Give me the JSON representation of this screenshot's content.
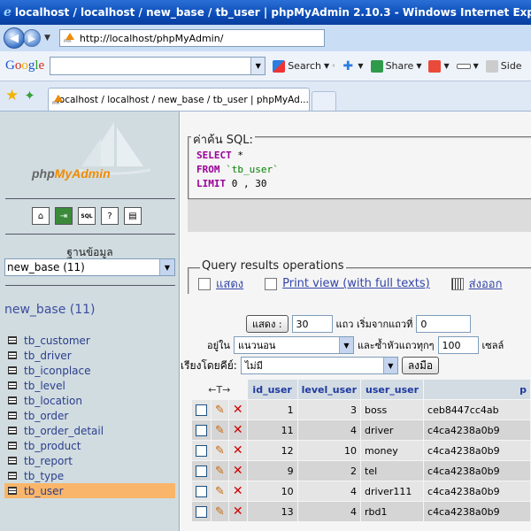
{
  "window": {
    "title": "localhost / localhost / new_base / tb_user | phpMyAdmin 2.10.3 - Windows Internet Explorer"
  },
  "address": {
    "url": "http://localhost/phpMyAdmin/"
  },
  "google_toolbar": {
    "logo": "Google",
    "search_label": "Search",
    "share_label": "Share",
    "side_label": "Side"
  },
  "tab": {
    "title": "localhost / localhost / new_base / tb_user | phpMyAd..."
  },
  "sidebar": {
    "logo_php": "php",
    "logo_myadmin": "MyAdmin",
    "db_label": "ฐานข้อมูล",
    "db_select_value": "new_base (11)",
    "db_title": "new_base (11)",
    "tables": [
      {
        "label": "tb_customer"
      },
      {
        "label": "tb_driver"
      },
      {
        "label": "tb_iconplace"
      },
      {
        "label": "tb_level"
      },
      {
        "label": "tb_location"
      },
      {
        "label": "tb_order"
      },
      {
        "label": "tb_order_detail"
      },
      {
        "label": "tb_product"
      },
      {
        "label": "tb_report"
      },
      {
        "label": "tb_type"
      },
      {
        "label": "tb_user",
        "active": true
      }
    ]
  },
  "sql_section": {
    "legend": "ค่าค้น SQL:",
    "kw_select": "SELECT",
    "select_rest": " *",
    "kw_from": "FROM",
    "from_rest": " `tb_user`",
    "kw_limit": "LIMIT",
    "limit_rest": " 0 , 30"
  },
  "query_ops": {
    "legend": "Query results operations",
    "show_label": "แสดง",
    "print_label": "Print view (with full texts)",
    "export_label": "ส่งออก"
  },
  "navigation": {
    "show_button": "แสดง :",
    "rows_value": "30",
    "rows_text": "แถว เริ่มจากแถวที่",
    "start_value": "0",
    "in_label": "อยู่ใน",
    "mode_value": "แนวนอน",
    "repeat_text": "และซ้ำหัวแถวทุกๆ",
    "repeat_value": "100",
    "cells_text": "เซลล์",
    "sort_label": "เรียงโดยคีย์:",
    "sort_value": "ไม่มี",
    "go_button": "ลงมือ"
  },
  "results": {
    "headers": [
      "←T→",
      "id_user",
      "level_user",
      "user_user",
      "p"
    ],
    "rows": [
      {
        "id": "1",
        "level": "3",
        "user": "boss",
        "pass": "ceb8447cc4ab"
      },
      {
        "id": "11",
        "level": "4",
        "user": "driver",
        "pass": "c4ca4238a0b9"
      },
      {
        "id": "12",
        "level": "10",
        "user": "money",
        "pass": "c4ca4238a0b9"
      },
      {
        "id": "9",
        "level": "2",
        "user": "tel",
        "pass": "c4ca4238a0b9"
      },
      {
        "id": "10",
        "level": "4",
        "user": "driver111",
        "pass": "c4ca4238a0b9"
      },
      {
        "id": "13",
        "level": "4",
        "user": "rbd1",
        "pass": "c4ca4238a0b9"
      }
    ]
  }
}
